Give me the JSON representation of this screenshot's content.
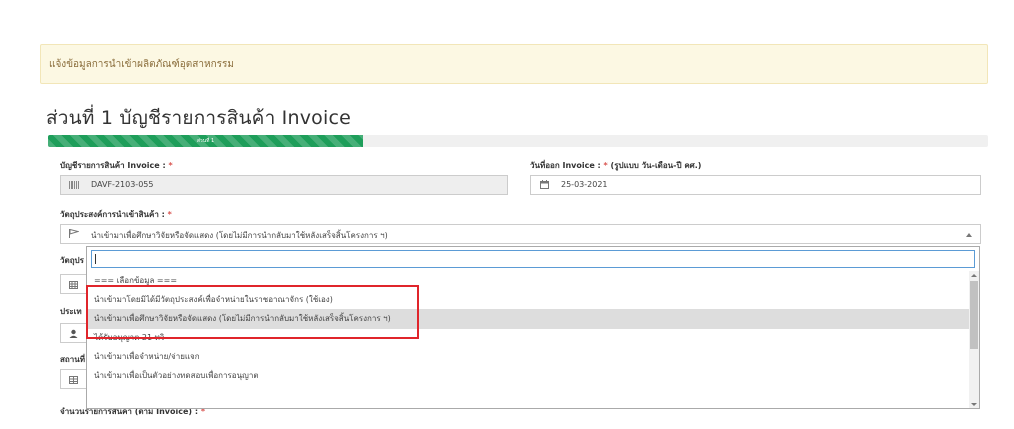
{
  "banner": {
    "text": "แจ้งข้อมูลการนำเข้าผลิตภัณฑ์อุตสาหกรรม"
  },
  "page": {
    "title": "ส่วนที่ 1 บัญชีรายการสินค้า Invoice"
  },
  "progress": {
    "label": "ส่วนที่ 1",
    "fraction": 0.335,
    "color": "#1e9e5a"
  },
  "form": {
    "invoice_list": {
      "label": "บัญชีรายการสินค้า Invoice :",
      "required_mark": "*",
      "value": "DAVF-2103-055",
      "icon": "barcode-icon"
    },
    "invoice_date": {
      "label": "วันที่ออก Invoice :",
      "required_mark": "*",
      "hint": "(รูปแบบ วัน-เดือน-ปี คศ.)",
      "value": "25-03-2021",
      "icon": "calendar-icon"
    },
    "purpose": {
      "label": "วัตถุประสงค์การนำเข้าสินค้า :",
      "required_mark": "*",
      "value": "นำเข้ามาเพื่อศึกษาวิจัยหรือจัดแสดง (โดยไม่มีการนำกลับมาใช้หลังเสร็จสิ้นโครงการ ฯ)",
      "icon": "flag-icon"
    },
    "partial_labels": {
      "second_purpose": "วัตถุปร",
      "country": "ประเท",
      "place": "สถานที่"
    },
    "bottom_label": {
      "label": "จำนวนรายการสินค้า (ตาม Invoice) :",
      "required_mark": "*"
    }
  },
  "dropdown": {
    "search_value": "",
    "options": [
      {
        "label": "=== เลือกข้อมูล ===",
        "highlighted": false
      },
      {
        "label": "นำเข้ามาโดยมิได้มีวัตถุประสงค์เพื่อจำหน่ายในราชอาณาจักร (ใช้เอง)",
        "highlighted": false
      },
      {
        "label": "นำเข้ามาเพื่อศึกษาวิจัยหรือจัดแสดง (โดยไม่มีการนำกลับมาใช้หลังเสร็จสิ้นโครงการ ฯ)",
        "highlighted": true
      },
      {
        "label": "ได้รับอนุญาต 21 ทวิ",
        "highlighted": false
      },
      {
        "label": "นำเข้ามาเพื่อจำหน่าย/จ่ายแจก",
        "highlighted": false
      },
      {
        "label": "นำเข้ามาเพื่อเป็นตัวอย่างทดสอบเพื่อการอนุญาต",
        "highlighted": false
      }
    ]
  },
  "colors": {
    "annotation": "#e0252b",
    "banner_bg": "#fcf8e3",
    "banner_text": "#8a6d3b"
  }
}
